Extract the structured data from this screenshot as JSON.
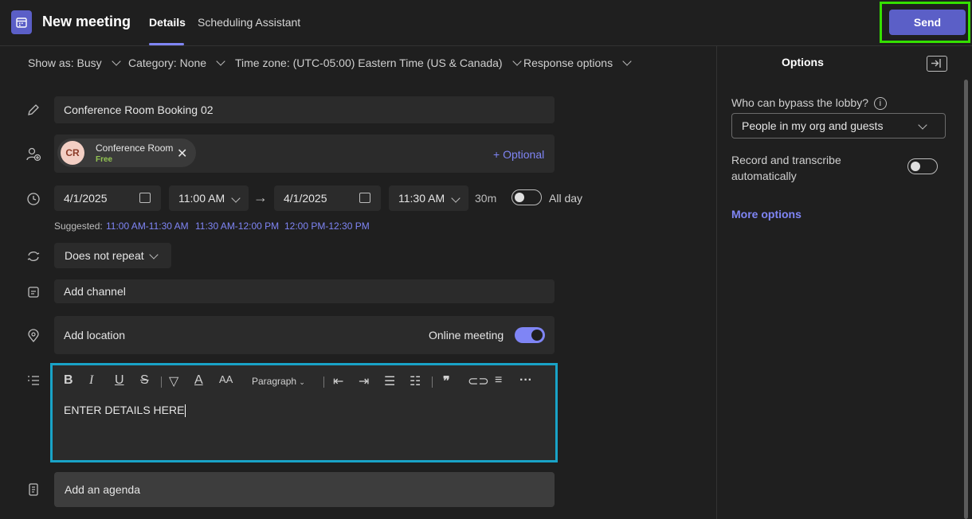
{
  "header": {
    "title": "New meeting",
    "tabs": [
      {
        "label": "Details",
        "active": true
      },
      {
        "label": "Scheduling Assistant",
        "active": false
      }
    ],
    "send_label": "Send"
  },
  "options_row": {
    "show_as": "Show as: Busy",
    "category": "Category: None",
    "time_zone": "Time zone: (UTC-05:00) Eastern Time (US & Canada)",
    "response": "Response options"
  },
  "form": {
    "title_value": "Conference Room Booking 02",
    "attendee": {
      "initials": "CR",
      "name": "Conference Room",
      "status": "Free"
    },
    "optional_label": "+ Optional",
    "start_date": "4/1/2025",
    "start_time": "11:00 AM",
    "end_date": "4/1/2025",
    "end_time": "11:30 AM",
    "duration": "30m",
    "all_day_label": "All day",
    "suggested_label": "Suggested:",
    "suggested_slots": [
      "11:00 AM-11:30 AM",
      "11:30 AM-12:00 PM",
      "12:00 PM-12:30 PM"
    ],
    "repeat": "Does not repeat",
    "channel_placeholder": "Add channel",
    "location_placeholder": "Add location",
    "online_meeting_label": "Online meeting",
    "editor": {
      "paragraph_label": "Paragraph",
      "body_text": "ENTER DETAILS HERE"
    },
    "agenda_label": "Add an agenda"
  },
  "options_panel": {
    "title": "Options",
    "lobby_label": "Who can bypass the lobby?",
    "lobby_value": "People in my org and guests",
    "record_label_line1": "Record and transcribe",
    "record_label_line2": "automatically",
    "more_options": "More options"
  },
  "colors": {
    "accent": "#5b5fc7",
    "accent_light": "#7f85f5",
    "send_highlight": "#35e000",
    "editor_highlight": "#19a3c7",
    "free_status": "#92c353"
  }
}
